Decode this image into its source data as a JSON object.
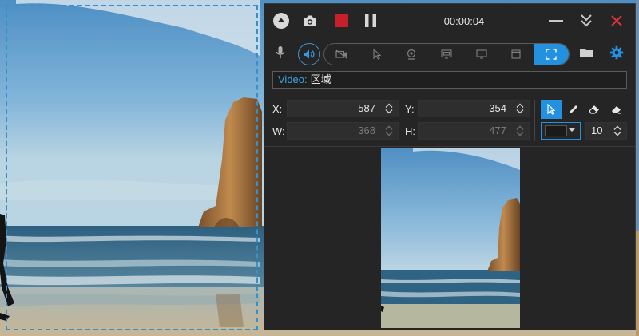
{
  "recorder": {
    "timer": "00:00:04",
    "video_label": "Video:",
    "video_value": "区域",
    "x_label": "X:",
    "x_value": "587",
    "y_label": "Y:",
    "y_value": "354",
    "w_label": "W:",
    "w_value": "368",
    "h_label": "H:",
    "h_value": "477",
    "pen_size": "10",
    "accent_color": "#2390e0",
    "stop_color": "#c8202a",
    "close_color": "#d9363e"
  },
  "titlebar_icons": [
    "eject-icon",
    "camera-icon",
    "stop-icon",
    "pause-icon",
    "minimize-icon",
    "collapse-icon",
    "close-icon"
  ],
  "mode_icons": [
    "no-camera-icon",
    "cursor-icon",
    "webcam-icon",
    "window-icon",
    "screen-icon",
    "app-window-icon",
    "region-icon"
  ],
  "drawing_tools": [
    "pointer-icon",
    "pen-icon",
    "eraser-icon",
    "clear-icon"
  ]
}
